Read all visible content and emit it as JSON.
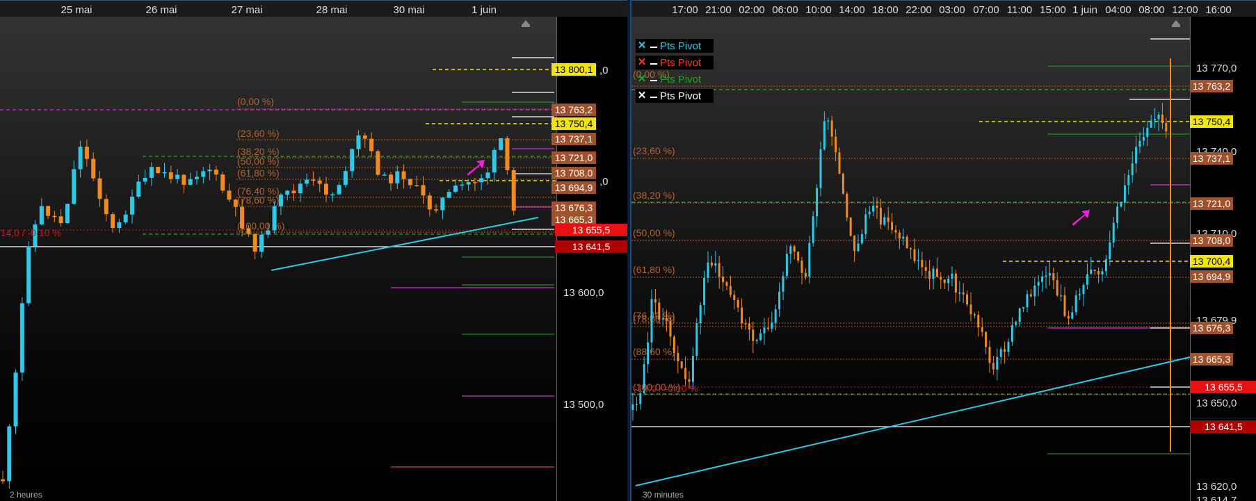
{
  "left": {
    "x_labels": [
      "25 mai",
      "26 mai",
      "27 mai",
      "28 mai",
      "30 mai",
      "1 juin"
    ],
    "timeframe": "2 heures",
    "axis_ticks": [
      "13 600,0",
      "13 500,0"
    ],
    "axis_fragments": [
      ",0",
      ",0"
    ],
    "price_tags": [
      {
        "text": "13 800,1",
        "bg": "#f2e600",
        "fg": "#000"
      },
      {
        "text": "13 763,2",
        "bg": "#a0522d",
        "fg": "#fff"
      },
      {
        "text": "13 750,4",
        "bg": "#f2e600",
        "fg": "#000"
      },
      {
        "text": "13 737,1",
        "bg": "#a0522d",
        "fg": "#fff"
      },
      {
        "text": "13 721,0",
        "bg": "#a0522d",
        "fg": "#fff"
      },
      {
        "text": "13 708,0",
        "bg": "#a0522d",
        "fg": "#fff"
      },
      {
        "text": "13 694,9",
        "bg": "#a0522d",
        "fg": "#fff"
      },
      {
        "text": "13 676,3",
        "bg": "#a0522d",
        "fg": "#fff"
      },
      {
        "text": "13 665,3",
        "bg": "#a0522d",
        "fg": "#fff"
      },
      {
        "text": "13 655,5",
        "bg": "#e81010",
        "fg": "#fff"
      },
      {
        "text": "13 641,5",
        "bg": "#b00000",
        "fg": "#fff"
      }
    ],
    "fib_labels": [
      "(0,00 %)",
      "(23,60 %)",
      "(38,20 %)",
      "(50,00 %)",
      "(61,80 %)",
      "(76,40 %)",
      "(78,60 %)",
      "(100,00 %)"
    ],
    "red_label": "-14,0 / -0,10 %"
  },
  "right": {
    "x_labels": [
      "17:00",
      "21:00",
      "02:00",
      "06:00",
      "10:00",
      "14:00",
      "18:00",
      "22:00",
      "03:00",
      "07:00",
      "11:00",
      "15:00",
      "1 juin",
      "04:00",
      "08:00",
      "12:00",
      "16:00"
    ],
    "timeframe": "30 minutes",
    "axis_ticks": [
      "13 770,0",
      "13 740,0",
      "13 710,0",
      "13 679,9",
      "13 650,0",
      "13 620,0",
      "13 614,7"
    ],
    "price_tags": [
      {
        "text": "13 763,2",
        "bg": "#a0522d",
        "fg": "#fff"
      },
      {
        "text": "13 750,4",
        "bg": "#f2e600",
        "fg": "#000"
      },
      {
        "text": "13 737,1",
        "bg": "#a0522d",
        "fg": "#fff"
      },
      {
        "text": "13 721,0",
        "bg": "#a0522d",
        "fg": "#fff"
      },
      {
        "text": "13 708,0",
        "bg": "#a0522d",
        "fg": "#fff"
      },
      {
        "text": "13 700,4",
        "bg": "#f2e600",
        "fg": "#000"
      },
      {
        "text": "13 694,9",
        "bg": "#a0522d",
        "fg": "#fff"
      },
      {
        "text": "13 676,3",
        "bg": "#a0522d",
        "fg": "#fff"
      },
      {
        "text": "13 665,3",
        "bg": "#a0522d",
        "fg": "#fff"
      },
      {
        "text": "13 655,5",
        "bg": "#e81010",
        "fg": "#fff"
      },
      {
        "text": "13 641,5",
        "bg": "#b00000",
        "fg": "#fff"
      }
    ],
    "fib_labels": [
      "(0,00 %)",
      "(23,60 %)",
      "(38,20 %)",
      "(50,00 %)",
      "(61,80 %)",
      "(76,40 %)",
      "(78,60 %)",
      "(88,60 %)",
      "(100,00 %)"
    ],
    "red_label": "-14,0 / -0,10 %",
    "legend": [
      {
        "label": "Pts Pivot",
        "x_color": "#2ec8e8",
        "text_color": "#2ec8e8"
      },
      {
        "label": "Pts Pivot",
        "x_color": "#ff3b1f",
        "text_color": "#ff3b1f"
      },
      {
        "label": "Pts Pivot",
        "x_color": "#1fa51f",
        "text_color": "#1fa51f"
      },
      {
        "label": "Pts Pivot",
        "x_color": "#ffffff",
        "text_color": "#ffffff"
      }
    ]
  },
  "colors": {
    "up": "#2ec8e8",
    "down": "#f28a1f",
    "fib": "#b5632d",
    "pivot_yellow": "#f2e600",
    "arrow": "#ff1ee6",
    "trend": "#2ec8e8"
  }
}
